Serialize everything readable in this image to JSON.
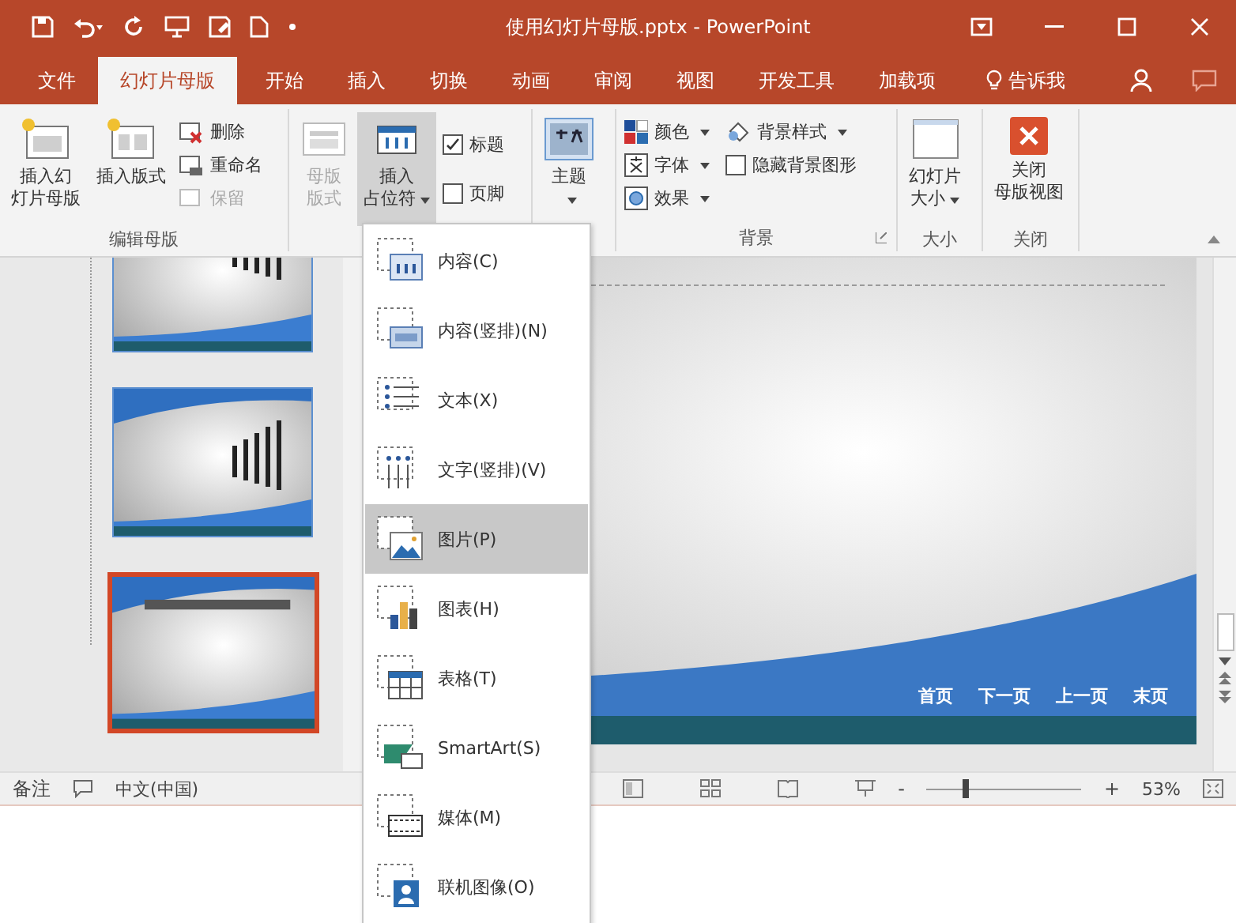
{
  "window": {
    "title": "使用幻灯片母版.pptx - PowerPoint"
  },
  "tabs": [
    {
      "label": "文件",
      "selected": false
    },
    {
      "label": "幻灯片母版",
      "selected": true
    },
    {
      "label": "开始",
      "selected": false
    },
    {
      "label": "插入",
      "selected": false
    },
    {
      "label": "切换",
      "selected": false
    },
    {
      "label": "动画",
      "selected": false
    },
    {
      "label": "审阅",
      "selected": false
    },
    {
      "label": "视图",
      "selected": false
    },
    {
      "label": "开发工具",
      "selected": false
    },
    {
      "label": "加载项",
      "selected": false
    }
  ],
  "tell_me": "告诉我",
  "ribbon": {
    "edit_master": {
      "label": "编辑母版",
      "insert_master": [
        "插入幻",
        "灯片母版"
      ],
      "insert_layout": "插入版式",
      "small": [
        {
          "label": "删除",
          "disabled": false
        },
        {
          "label": "重命名",
          "disabled": false
        },
        {
          "label": "保留",
          "disabled": true
        }
      ]
    },
    "master_layout": {
      "layout_button": {
        "label": [
          "母版",
          "版式"
        ],
        "disabled": true
      },
      "placeholder_button": {
        "label": [
          "插入",
          "占位符"
        ],
        "pressed": true
      },
      "checks": [
        {
          "label": "标题",
          "checked": true
        },
        {
          "label": "页脚",
          "checked": false
        }
      ]
    },
    "theme": {
      "label": "主题"
    },
    "background": {
      "label": "背景",
      "items": [
        {
          "kind": "colors",
          "label": "颜色"
        },
        {
          "kind": "fonts",
          "label": "字体"
        },
        {
          "kind": "effects",
          "label": "效果"
        }
      ],
      "styles": "背景样式",
      "hide_graphics": {
        "label": "隐藏背景图形",
        "checked": false
      }
    },
    "size": {
      "label": "大小",
      "button": [
        "幻灯片",
        "大小"
      ]
    },
    "close": {
      "label": "关闭",
      "button": [
        "关闭",
        "母版视图"
      ]
    }
  },
  "thumbnails": [
    {
      "selected": false
    },
    {
      "selected": false
    },
    {
      "selected": true
    }
  ],
  "slide": {
    "nav": [
      "首页",
      "下一页",
      "上一页",
      "末页"
    ]
  },
  "menu": {
    "items": [
      {
        "kind": "content",
        "label": "内容(C)",
        "selected": false
      },
      {
        "kind": "content_vertical",
        "label": "内容(竖排)(N)",
        "selected": false
      },
      {
        "kind": "text",
        "label": "文本(X)",
        "selected": false
      },
      {
        "kind": "text_vertical",
        "label": "文字(竖排)(V)",
        "selected": false
      },
      {
        "kind": "picture",
        "label": "图片(P)",
        "selected": true
      },
      {
        "kind": "chart",
        "label": "图表(H)",
        "selected": false
      },
      {
        "kind": "table",
        "label": "表格(T)",
        "selected": false
      },
      {
        "kind": "smartart",
        "label": "SmartArt(S)",
        "selected": false
      },
      {
        "kind": "media",
        "label": "媒体(M)",
        "selected": false
      },
      {
        "kind": "online_picture",
        "label": "联机图像(O)",
        "selected": false
      }
    ]
  },
  "status_bar": {
    "notes": "备注",
    "language": "中文(中国)",
    "zoom_out": "-",
    "zoom_in": "+",
    "zoom": {
      "level": 0.25
    },
    "zoom_reading": "53%"
  }
}
